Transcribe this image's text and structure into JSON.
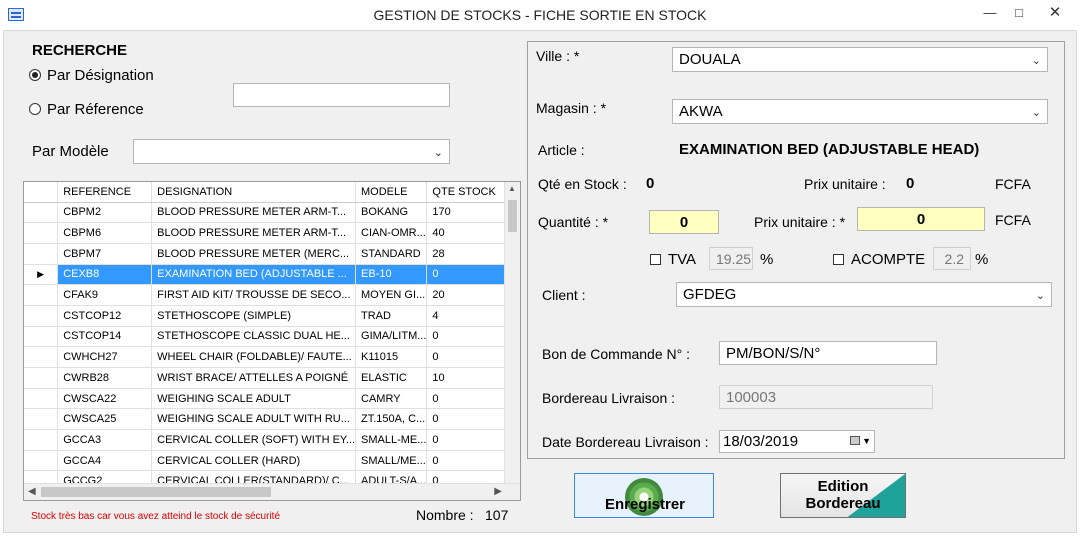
{
  "window": {
    "title": "GESTION DE STOCKS - FICHE SORTIE EN STOCK"
  },
  "search": {
    "heading": "RECHERCHE",
    "radio_designation": "Par Désignation",
    "radio_reference": "Par Réference",
    "search_value": "",
    "modele_label": "Par Modèle",
    "modele_value": ""
  },
  "grid": {
    "columns": [
      "REFERENCE",
      "DESIGNATION",
      "MODELE",
      "QTE STOCK"
    ],
    "selected_index": 3,
    "rows": [
      {
        "ref": "CBPM2",
        "designation": "BLOOD PRESSURE METER ARM-T...",
        "modele": "BOKANG",
        "qte": "170"
      },
      {
        "ref": "CBPM6",
        "designation": "BLOOD PRESSURE METER ARM-T...",
        "modele": "CIAN-OMR...",
        "qte": "40"
      },
      {
        "ref": "CBPM7",
        "designation": "BLOOD PRESSURE METER (MERC...",
        "modele": "STANDARD",
        "qte": "28"
      },
      {
        "ref": "CEXB8",
        "designation": "EXAMINATION BED (ADJUSTABLE ...",
        "modele": "EB-10",
        "qte": "0"
      },
      {
        "ref": "CFAK9",
        "designation": "FIRST AID KIT/ TROUSSE DE SECO...",
        "modele": "MOYEN GI...",
        "qte": "20"
      },
      {
        "ref": "CSTCOP12",
        "designation": "STETHOSCOPE (SIMPLE)",
        "modele": "TRAD",
        "qte": "4"
      },
      {
        "ref": "CSTCOP14",
        "designation": "STETHOSCOPE  CLASSIC DUAL HE...",
        "modele": "GIMA/LITM...",
        "qte": "0"
      },
      {
        "ref": "CWHCH27",
        "designation": "WHEEL CHAIR (FOLDABLE)/ FAUTE...",
        "modele": "K11015",
        "qte": "0"
      },
      {
        "ref": "CWRB28",
        "designation": "WRIST BRACE/ ATTELLES A POIGNÉ",
        "modele": "ELASTIC",
        "qte": "10"
      },
      {
        "ref": "CWSCA22",
        "designation": "WEIGHING SCALE ADULT",
        "modele": "CAMRY",
        "qte": "0"
      },
      {
        "ref": "CWSCA25",
        "designation": "WEIGHING SCALE ADULT WITH RU...",
        "modele": "ZT.150A, C...",
        "qte": "0"
      },
      {
        "ref": "GCCA3",
        "designation": "CERVICAL COLLER (SOFT) WITH EY...",
        "modele": "SMALL-ME...",
        "qte": "0"
      },
      {
        "ref": "GCCA4",
        "designation": "CERVICAL COLLER (HARD)",
        "modele": "SMALL/ME...",
        "qte": "0"
      },
      {
        "ref": "GCCG2",
        "designation": "CERVICAL COLLER(STANDARD)/ C...",
        "modele": "ADULT-S/A...",
        "qte": "0"
      }
    ]
  },
  "footer": {
    "warning": "Stock très bas car vous avez atteind le stock de sécurité",
    "nombre_label": "Nombre :",
    "nombre_value": "107"
  },
  "form": {
    "ville_label": "Ville : *",
    "ville_value": "DOUALA",
    "magasin_label": "Magasin : *",
    "magasin_value": "AKWA",
    "article_label": "Article :",
    "article_value": "EXAMINATION BED (ADJUSTABLE HEAD)",
    "qte_stock_label": "Qté en Stock :",
    "qte_stock_value": "0",
    "prix_unitaire_label": "Prix unitaire  :",
    "prix_unitaire_value": "0",
    "fcfa": "FCFA",
    "quantite_label": "Quantité : *",
    "quantite_value": "0",
    "prix_unitaire_input_label": "Prix unitaire : *",
    "prix_unitaire_input_value": "0",
    "tva_label": "TVA",
    "tva_value": "19.25",
    "percent": "%",
    "acompte_label": "ACOMPTE",
    "acompte_value": "2.2",
    "client_label": "Client :",
    "client_value": "GFDEG",
    "bon_commande_label": "Bon de Commande N° :",
    "bon_commande_value": "PM/BON/S/N°",
    "bordereau_label": "Bordereau Livraison :",
    "bordereau_value": "100003",
    "date_bordereau_label": "Date Bordereau Livraison :",
    "date_bordereau_value": "18/03/2019"
  },
  "buttons": {
    "enregistrer": "Enregistrer",
    "edition_line1": "Edition",
    "edition_line2": "Bordereau"
  },
  "colors": {
    "selection": "#3399ff",
    "highlight_input": "#ffffc0",
    "warning": "#e00000",
    "button_accent": "#1ea29a"
  }
}
